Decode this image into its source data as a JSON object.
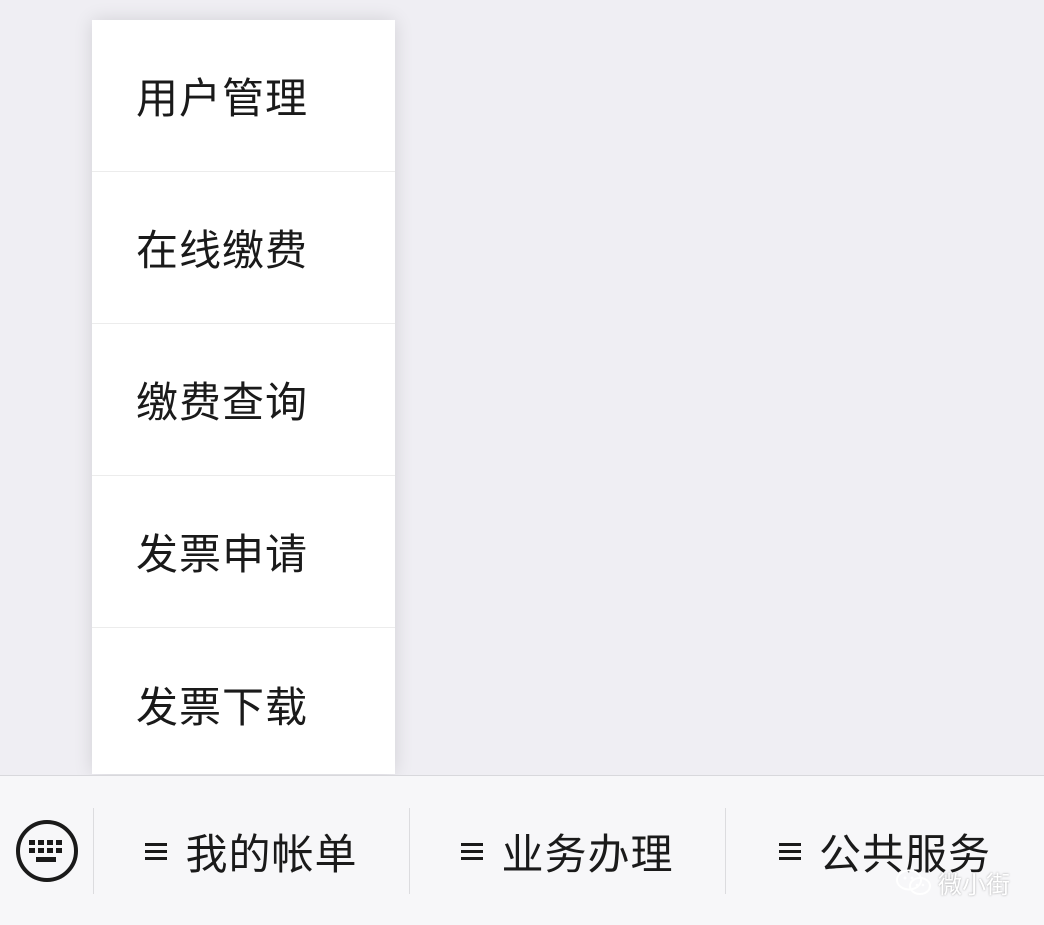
{
  "popup_menu": {
    "items": [
      {
        "label": "用户管理"
      },
      {
        "label": "在线缴费"
      },
      {
        "label": "缴费查询"
      },
      {
        "label": "发票申请"
      },
      {
        "label": "发票下载"
      }
    ]
  },
  "bottom_bar": {
    "keyboard_icon": "keyboard-icon",
    "tabs": [
      {
        "label": "我的帐单",
        "icon": "menu-icon"
      },
      {
        "label": "业务办理",
        "icon": "menu-icon"
      },
      {
        "label": "公共服务",
        "icon": "menu-icon"
      }
    ]
  },
  "watermark": {
    "text": "微小街",
    "icon": "wechat-icon"
  },
  "colors": {
    "background": "#efeef3",
    "menu_background": "#ffffff",
    "bar_background": "#f7f7f9",
    "text": "#1a1a1a"
  }
}
